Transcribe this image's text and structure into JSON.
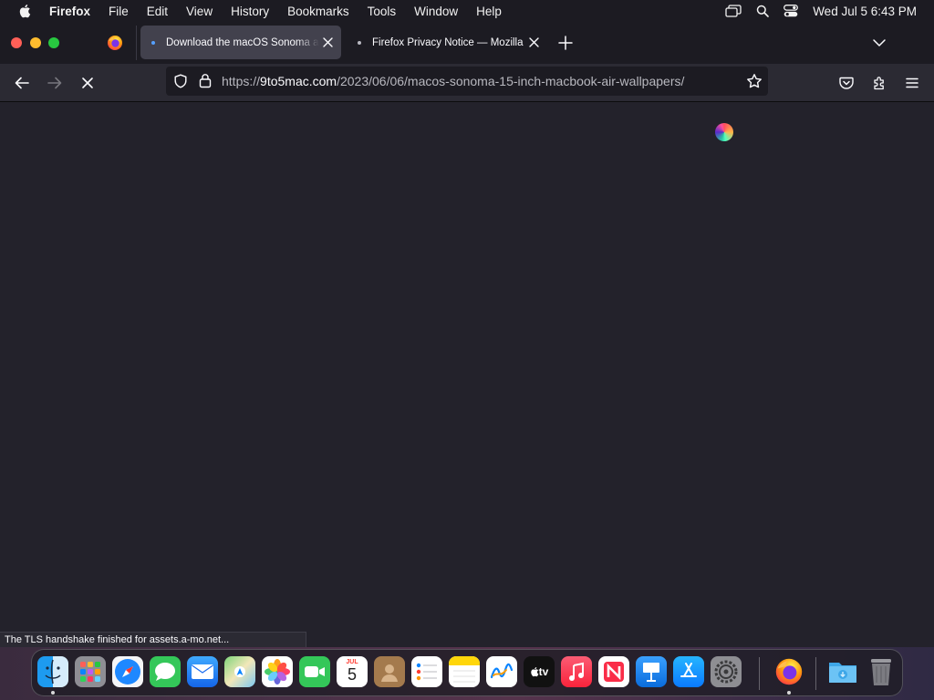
{
  "menubar": {
    "app_name": "Firefox",
    "menus": [
      "File",
      "Edit",
      "View",
      "History",
      "Bookmarks",
      "Tools",
      "Window",
      "Help"
    ],
    "clock": "Wed Jul 5  6:43 PM"
  },
  "tabs": [
    {
      "title": "Download the macOS Sonoma and",
      "active": true
    },
    {
      "title": "Firefox Privacy Notice — Mozilla",
      "active": false
    }
  ],
  "navbar": {
    "url_scheme": "https://",
    "url_host": "9to5mac.com",
    "url_path": "/2023/06/06/macos-sonoma-15-inch-macbook-air-wallpapers/"
  },
  "status": {
    "text": "The TLS handshake finished for assets.a-mo.net..."
  },
  "dock": {
    "calendar_month": "JUL",
    "calendar_day": "5",
    "tv_label": "tv",
    "apps": [
      "Finder",
      "Launchpad",
      "Safari",
      "Messages",
      "Mail",
      "Maps",
      "Photos",
      "FaceTime",
      "Calendar",
      "Contacts",
      "Reminders",
      "Notes",
      "Freeform",
      "TV",
      "Music",
      "News",
      "Keynote",
      "App Store",
      "System Settings",
      "Firefox",
      "Downloads",
      "Trash"
    ]
  },
  "colors": {
    "accent": "#56a0ff",
    "content_bg": "#23222b",
    "toolbar_bg": "#2b2a33"
  }
}
